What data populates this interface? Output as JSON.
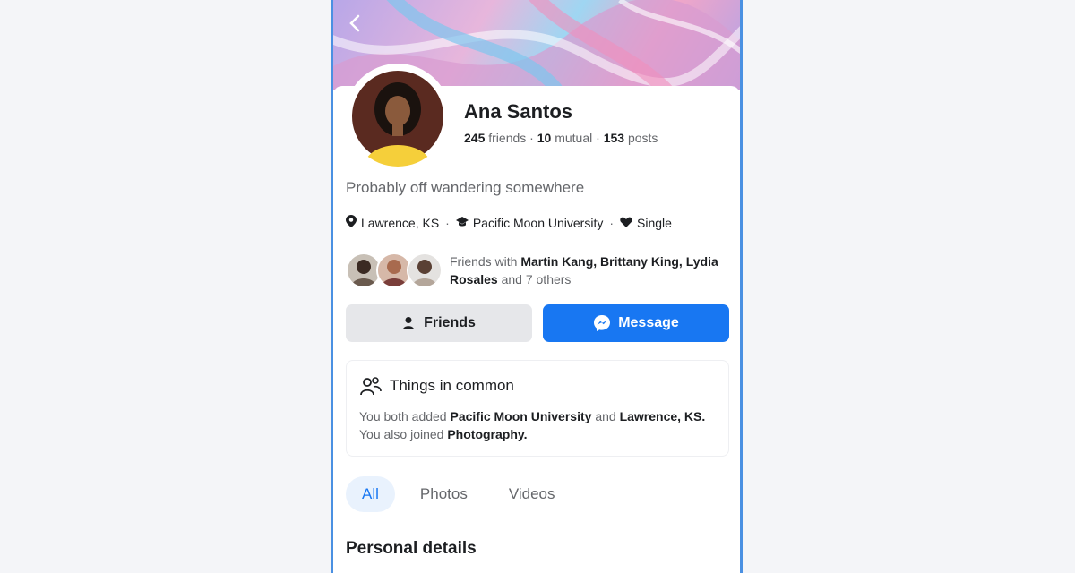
{
  "header": {
    "back_icon": "chevron-left-icon"
  },
  "profile": {
    "name": "Ana Santos",
    "friends_count": "245",
    "friends_label": "friends",
    "mutual_count": "10",
    "mutual_label": "mutual",
    "posts_count": "153",
    "posts_label": "posts",
    "separator": "·",
    "bio": "Probably off wandering somewhere"
  },
  "details": {
    "location_icon": "map-pin-icon",
    "location": "Lawrence, KS",
    "school_icon": "graduation-cap-icon",
    "school": "Pacific Moon University",
    "relationship_icon": "heart-icon",
    "relationship": "Single",
    "separator": "·"
  },
  "mutual_friends": {
    "prefix": "Friends with",
    "names": [
      "Martin Kang,",
      "Brittany King,",
      "Lydia Rosales"
    ],
    "suffix": "and 7 others"
  },
  "actions": {
    "friends_label": "Friends",
    "friends_icon": "person-icon",
    "message_label": "Message",
    "message_icon": "messenger-icon"
  },
  "things_in_common": {
    "icon": "people-icon",
    "title": "Things in common",
    "text_1": "You both added",
    "item_1": "Pacific Moon University",
    "text_2": "and",
    "item_2": "Lawrence, KS.",
    "text_3": "You also joined",
    "item_3": "Photography."
  },
  "tabs": [
    {
      "label": "All",
      "active": true
    },
    {
      "label": "Photos",
      "active": false
    },
    {
      "label": "Videos",
      "active": false
    }
  ],
  "section": {
    "title": "Personal details"
  },
  "colors": {
    "accent": "#1877f2",
    "frame": "#4a90e2",
    "secondary_button": "#e6e7ea"
  }
}
